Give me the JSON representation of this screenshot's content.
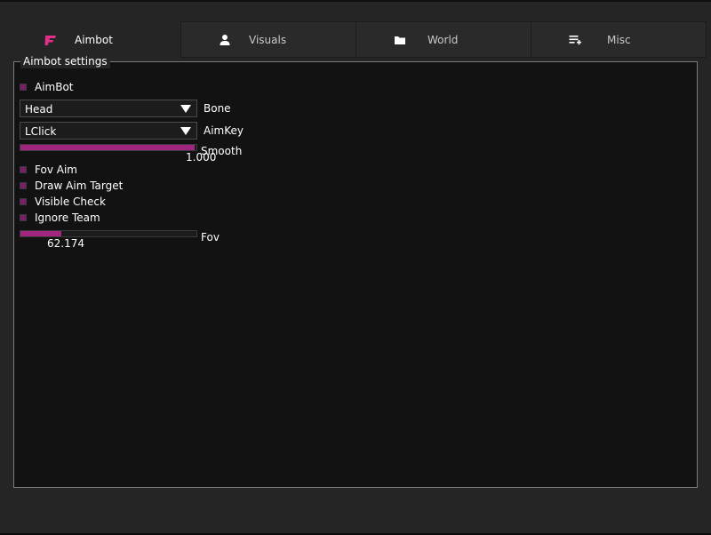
{
  "tabs": [
    {
      "label": "Aimbot",
      "icon": "aimbot-icon",
      "active": true
    },
    {
      "label": "Visuals",
      "icon": "user-icon",
      "active": false
    },
    {
      "label": "World",
      "icon": "folder-icon",
      "active": false
    },
    {
      "label": "Misc",
      "icon": "list-add-icon",
      "active": false
    }
  ],
  "group": {
    "title": "Aimbot settings",
    "aimbot_checkbox": {
      "label": "AimBot",
      "checked": false
    },
    "bone": {
      "value": "Head",
      "label": "Bone"
    },
    "aimkey": {
      "value": "LClick",
      "label": "AimKey"
    },
    "smooth": {
      "label": "Smooth",
      "value": "1.000",
      "fraction": 0.99
    },
    "checkboxes": [
      {
        "label": "Fov Aim",
        "checked": false
      },
      {
        "label": "Draw Aim Target",
        "checked": false
      },
      {
        "label": "Visible Check",
        "checked": false
      },
      {
        "label": "Ignore Team",
        "checked": false
      }
    ],
    "fov": {
      "label": "Fov",
      "value": "62.174",
      "fraction": 0.23
    }
  },
  "colors": {
    "accent": "#a0267f",
    "accent_icon": "#e0308a",
    "panel_bg": "#121212",
    "window_bg": "#252525"
  }
}
